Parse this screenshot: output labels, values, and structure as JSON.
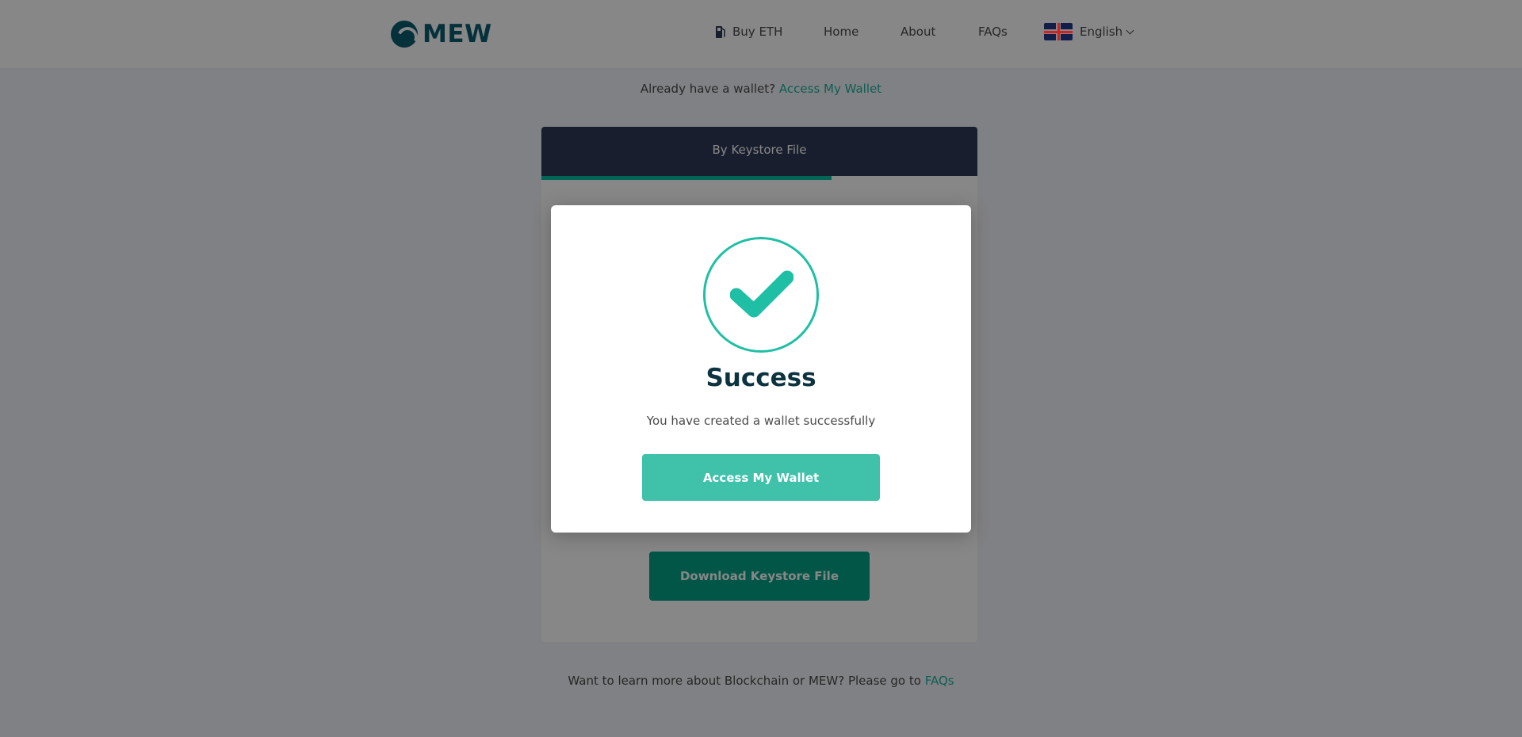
{
  "header": {
    "logo_text": "MEW",
    "nav": {
      "buy_eth": "Buy ETH",
      "home": "Home",
      "about": "About",
      "faqs": "FAQs",
      "language": "English"
    }
  },
  "main": {
    "already_text": "Already have a wallet?",
    "already_link": "Access My Wallet",
    "tab_label": "By Keystore File",
    "download_button": "Download Keystore File",
    "learn_text": "Want to learn more about Blockchain or MEW? Please go to",
    "learn_link": "FAQs"
  },
  "modal": {
    "icon": "checkmark-icon",
    "title": "Success",
    "message": "You have created a wallet successfully",
    "button": "Access My Wallet"
  },
  "colors": {
    "accent": "#1fbfa5",
    "brand": "#0b5d70",
    "tab_bar": "#2e3a56"
  }
}
